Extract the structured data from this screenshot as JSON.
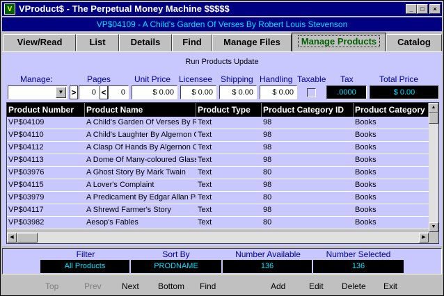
{
  "window": {
    "title": "VProduct$ - The Perpetual Money Machine $$$$$",
    "record_title": "VP$04109 - A Child's Garden Of Verses By Robert Louis Stevenson"
  },
  "tabs": [
    "View/Read",
    "List",
    "Details",
    "Find",
    "Manage Files",
    "Manage Products",
    "Catalog"
  ],
  "manage": {
    "heading": "Run Products Update",
    "labels": {
      "manage": "Manage:",
      "pages": "Pages",
      "unit_price": "Unit Price",
      "licensee": "Licensee",
      "shipping": "Shipping",
      "handling": "Handling",
      "taxable": "Taxable",
      "tax": "Tax",
      "total_price": "Total Price"
    },
    "values": {
      "pages_gt_symbol": ">",
      "pages_from": "0",
      "pages_lt_symbol": "<",
      "pages_to": "0",
      "unit_price": "$ 0.00",
      "licensee": "$ 0.00",
      "shipping": "$ 0.00",
      "handling": "$ 0.00",
      "tax": ".0000",
      "total_price": "$ 0.00"
    }
  },
  "grid": {
    "columns": [
      "Product Number",
      "Product Name",
      "Product Type",
      "Product Category ID",
      "Product Category"
    ],
    "rows": [
      [
        "VP$04109",
        "A Child's Garden Of Verses By R",
        "Text",
        "98",
        "Books"
      ],
      [
        "VP$04110",
        "A Child's Laughter By Algernon C",
        "Text",
        "98",
        "Books"
      ],
      [
        "VP$04112",
        "A Clasp Of Hands By Algernon C",
        "Text",
        "98",
        "Books"
      ],
      [
        "VP$04113",
        "A Dome Of Many-coloured Glass",
        "Text",
        "98",
        "Books"
      ],
      [
        "VP$03976",
        "A Ghost Story By Mark Twain",
        "Text",
        "80",
        "Books"
      ],
      [
        "VP$04115",
        "A Lover's Complaint",
        "Text",
        "98",
        "Books"
      ],
      [
        "VP$03979",
        "A Predicament By Edgar Allan Po",
        "Text",
        "80",
        "Books"
      ],
      [
        "VP$04117",
        "A Shrewd Farmer's Story",
        "Text",
        "98",
        "Books"
      ],
      [
        "VP$03982",
        "Aesop's Fables",
        "Text",
        "80",
        "Books"
      ]
    ]
  },
  "status": {
    "filter_label": "Filter",
    "filter_value": "All Products",
    "sort_label": "Sort By",
    "sort_value": "PRODNAME",
    "available_label": "Number Available",
    "available_value": "136",
    "selected_label": "Number Selected",
    "selected_value": "136"
  },
  "nav": {
    "top": "Top",
    "prev": "Prev",
    "next": "Next",
    "bottom": "Bottom",
    "find": "Find",
    "add": "Add",
    "edit": "Edit",
    "delete": "Delete",
    "exit": "Exit"
  }
}
